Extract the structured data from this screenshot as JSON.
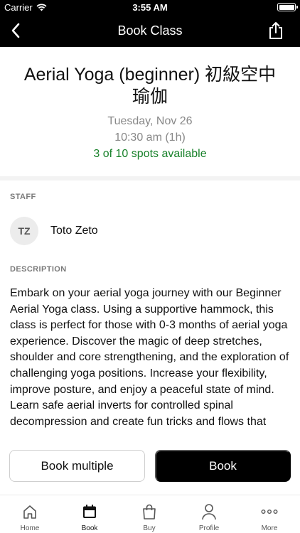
{
  "status_bar": {
    "carrier": "Carrier",
    "time": "3:55 AM"
  },
  "nav": {
    "title": "Book Class",
    "back_icon": "chevron-left-icon",
    "share_icon": "share-icon"
  },
  "class": {
    "title": "Aerial Yoga (beginner) 初級空中瑜伽",
    "date": "Tuesday, Nov 26",
    "time": "10:30 am (1h)",
    "spots": "3 of 10 spots available"
  },
  "staff": {
    "label": "STAFF",
    "initials": "TZ",
    "name": "Toto Zeto"
  },
  "description": {
    "label": "DESCRIPTION",
    "text": "Embark on your aerial yoga journey with our Beginner Aerial Yoga class. Using a supportive hammock, this class is perfect for those with 0-3 months of aerial yoga experience. Discover the magic of deep stretches, shoulder and core strengthening, and the exploration of challenging yoga positions. Increase your flexibility, improve posture, and enjoy a peaceful state of mind. Learn safe aerial inverts for controlled spinal decompression and create fun tricks and flows that"
  },
  "actions": {
    "book_multiple": "Book multiple",
    "book": "Book"
  },
  "tabs": [
    {
      "label": "Home",
      "icon": "home-icon"
    },
    {
      "label": "Book",
      "icon": "calendar-icon"
    },
    {
      "label": "Buy",
      "icon": "shopping-bag-icon"
    },
    {
      "label": "Profile",
      "icon": "person-icon"
    },
    {
      "label": "More",
      "icon": "more-dots-icon"
    }
  ],
  "colors": {
    "accent": "#000000",
    "spots": "#18812a",
    "muted": "#888888"
  }
}
